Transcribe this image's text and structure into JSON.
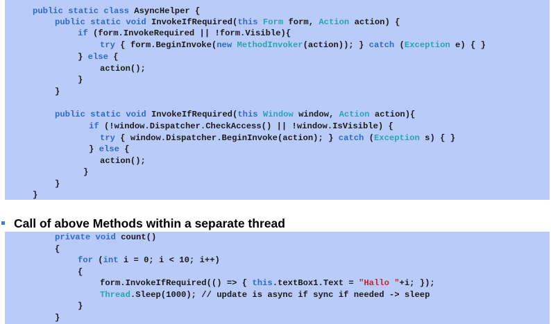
{
  "section_heading": "Call of above Methods within a separate thread",
  "code_block_1": [
    [
      [
        "kw",
        "public static class "
      ],
      [
        "t",
        "AsyncHelper {"
      ]
    ],
    [
      [
        "kw",
        "public static void "
      ],
      [
        "t",
        "InvokeIfRequired("
      ],
      [
        "kw",
        "this "
      ],
      [
        "ty",
        "Form "
      ],
      [
        "t",
        "form, "
      ],
      [
        "ty",
        "Action "
      ],
      [
        "t",
        "action) {"
      ]
    ],
    [
      [
        "kw",
        "if "
      ],
      [
        "t",
        "(form.InvokeRequired || !form.Visible){"
      ]
    ],
    [
      [
        "kw",
        "try "
      ],
      [
        "t",
        "{ form.BeginInvoke("
      ],
      [
        "kw",
        "new "
      ],
      [
        "ty",
        "MethodInvoker"
      ],
      [
        "t",
        "(action)); } "
      ],
      [
        "kw",
        "catch "
      ],
      [
        "t",
        "("
      ],
      [
        "ty",
        "Exception "
      ],
      [
        "t",
        "e) { }"
      ]
    ],
    [
      [
        "t",
        "} "
      ],
      [
        "kw",
        "else "
      ],
      [
        "t",
        "{"
      ]
    ],
    [
      [
        "t",
        "action();"
      ]
    ],
    [
      [
        "t",
        "}"
      ]
    ],
    [
      [
        "t",
        "}"
      ]
    ],
    [],
    [
      [
        "kw",
        "public static void "
      ],
      [
        "t",
        "InvokeIfRequired("
      ],
      [
        "kw",
        "this "
      ],
      [
        "ty",
        "Window "
      ],
      [
        "t",
        "window, "
      ],
      [
        "ty",
        "Action "
      ],
      [
        "t",
        "action){"
      ]
    ],
    [
      [
        "kw",
        "if "
      ],
      [
        "t",
        "(!window.Dispatcher.CheckAccess() || !window.IsVisible) {"
      ]
    ],
    [
      [
        "kw",
        "try "
      ],
      [
        "t",
        "{ window.Dispatcher.BeginInvoke(action); } "
      ],
      [
        "kw",
        "catch "
      ],
      [
        "t",
        "("
      ],
      [
        "ty",
        "Exception "
      ],
      [
        "t",
        "s) { }"
      ]
    ],
    [
      [
        "t",
        "} "
      ],
      [
        "kw",
        "else "
      ],
      [
        "t",
        "{"
      ]
    ],
    [
      [
        "t",
        "action();"
      ]
    ],
    [
      [
        "t",
        "}"
      ]
    ],
    [
      [
        "t",
        "}"
      ]
    ],
    [
      [
        "t",
        "}"
      ]
    ]
  ],
  "code_block_2": [
    [
      [
        "kw",
        "private void "
      ],
      [
        "t",
        "count()"
      ]
    ],
    [
      [
        "t",
        "{"
      ]
    ],
    [
      [
        "kw",
        "for "
      ],
      [
        "t",
        "("
      ],
      [
        "kw",
        "int "
      ],
      [
        "t",
        "i = 0; i < 10; i++)"
      ]
    ],
    [
      [
        "t",
        "{"
      ]
    ],
    [
      [
        "t",
        "form.InvokeIfRequired(() => { "
      ],
      [
        "kw",
        "this"
      ],
      [
        "t",
        ".textBox1.Text = "
      ],
      [
        "st",
        "\"Hallo \""
      ],
      [
        "t",
        "+i; });"
      ]
    ],
    [
      [
        "ty",
        "Thread"
      ],
      [
        "t",
        ".Sleep(1000); // update is async if sync if needed -> sleep"
      ]
    ],
    [
      [
        "t",
        "}"
      ]
    ],
    [
      [
        "t",
        "}"
      ]
    ]
  ]
}
